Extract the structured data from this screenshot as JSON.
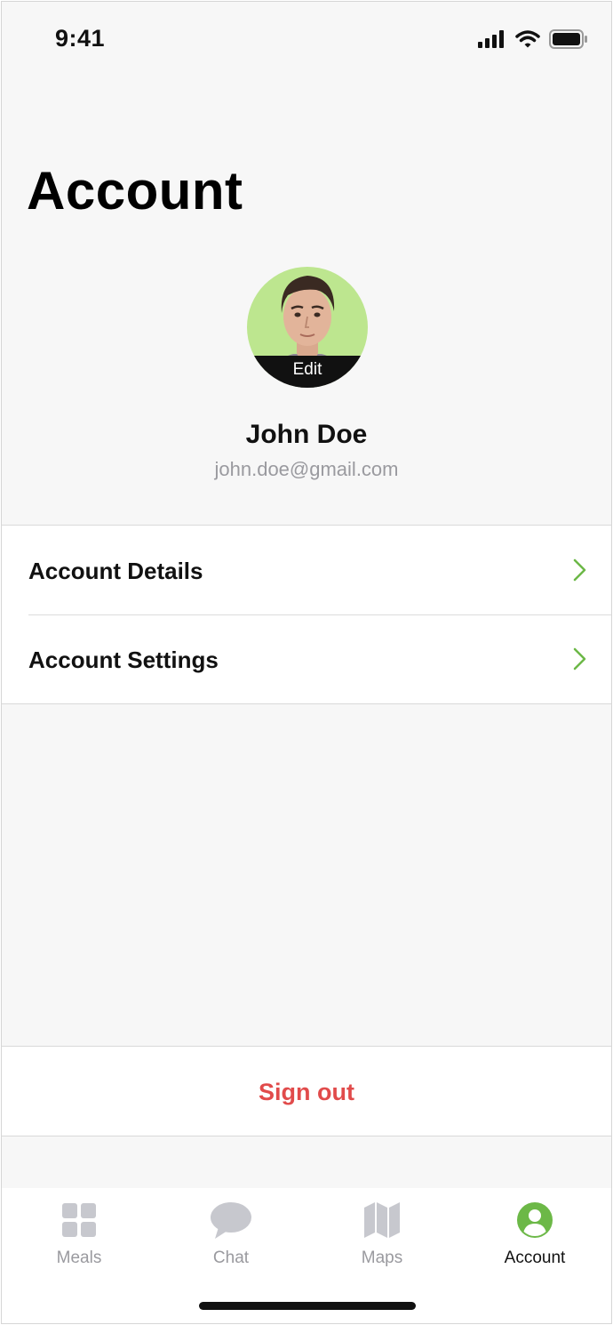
{
  "status_bar": {
    "time": "9:41",
    "icons": [
      "signal-icon",
      "wifi-icon",
      "battery-icon"
    ]
  },
  "page": {
    "title": "Account"
  },
  "profile": {
    "avatar_edit_label": "Edit",
    "name": "John Doe",
    "email": "john.doe@gmail.com"
  },
  "menu": {
    "items": [
      {
        "label": "Account Details",
        "icon": "chevron-right-icon"
      },
      {
        "label": "Account Settings",
        "icon": "chevron-right-icon"
      }
    ]
  },
  "actions": {
    "sign_out_label": "Sign out"
  },
  "tab_bar": {
    "tabs": [
      {
        "label": "Meals",
        "icon": "grid-icon",
        "active": false
      },
      {
        "label": "Chat",
        "icon": "chat-bubble-icon",
        "active": false
      },
      {
        "label": "Maps",
        "icon": "map-icon",
        "active": false
      },
      {
        "label": "Account",
        "icon": "user-circle-icon",
        "active": true
      }
    ]
  },
  "colors": {
    "accent": "#6cb847",
    "destructive": "#e14b4b",
    "inactive": "#c7c8ce",
    "avatar_background": "#bde68f",
    "background": "#f7f7f7"
  }
}
